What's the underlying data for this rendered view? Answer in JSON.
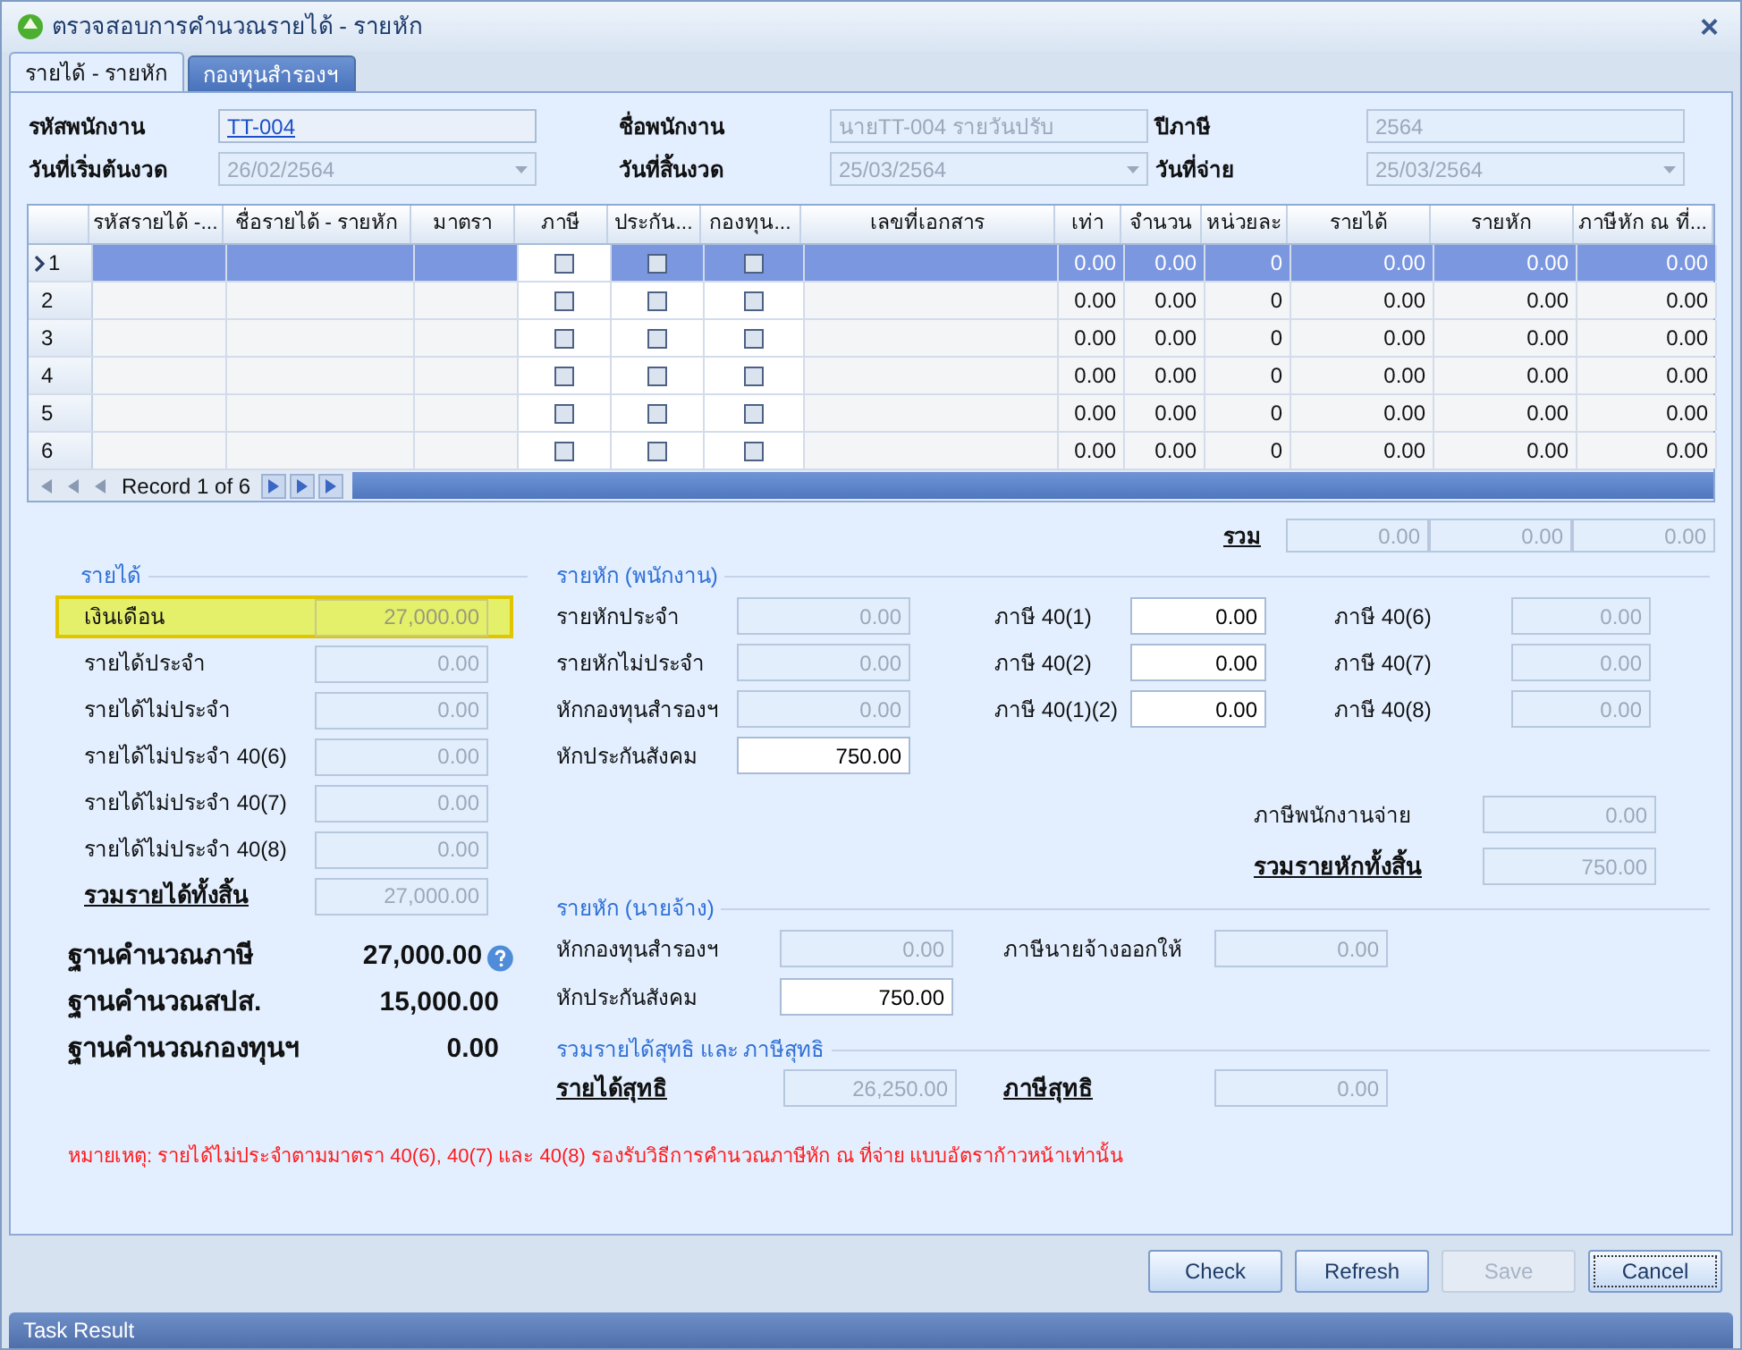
{
  "window": {
    "title": "ตรวจสอบการคำนวณรายได้ - รายหัก",
    "close": "×"
  },
  "tabs": [
    {
      "label": "รายได้ - รายหัก",
      "selected": true
    },
    {
      "label": "กองทุนสำรองฯ",
      "selected": false
    }
  ],
  "header_fields": [
    {
      "label": "รหัสพนักงาน",
      "value": "TT-004",
      "kind": "link"
    },
    {
      "label": "ชื่อพนักงาน",
      "value": "นายTT-004 รายวันปรับ",
      "kind": "text"
    },
    {
      "label": "ปีภาษี",
      "value": "2564",
      "kind": "text"
    },
    {
      "label": "วันที่เริ่มต้นงวด",
      "value": "26/02/2564",
      "kind": "date"
    },
    {
      "label": "วันที่สิ้นงวด",
      "value": "25/03/2564",
      "kind": "date"
    },
    {
      "label": "วันที่จ่าย",
      "value": "25/03/2564",
      "kind": "date"
    }
  ],
  "table": {
    "columns": [
      "รหัสรายได้ -...",
      "ชื่อรายได้ - รายหัก",
      "มาตรา",
      "ภาษี",
      "ประกัน...",
      "กองทุน...",
      "เลขที่เอกสาร",
      "เท่า",
      "จำนวน",
      "หน่วยละ",
      "รายได้",
      "รายหัก",
      "ภาษีหัก ณ ที่..."
    ],
    "rows": [
      {
        "number": "1",
        "selected": true,
        "tax": false,
        "insurance": false,
        "fund": false,
        "values": [
          "0.00",
          "0.00",
          "0",
          "0.00",
          "0.00",
          "0.00"
        ]
      },
      {
        "number": "2",
        "selected": false,
        "tax": false,
        "insurance": false,
        "fund": false,
        "values": [
          "0.00",
          "0.00",
          "0",
          "0.00",
          "0.00",
          "0.00"
        ]
      },
      {
        "number": "3",
        "selected": false,
        "tax": false,
        "insurance": false,
        "fund": false,
        "values": [
          "0.00",
          "0.00",
          "0",
          "0.00",
          "0.00",
          "0.00"
        ]
      },
      {
        "number": "4",
        "selected": false,
        "tax": false,
        "insurance": false,
        "fund": false,
        "values": [
          "0.00",
          "0.00",
          "0",
          "0.00",
          "0.00",
          "0.00"
        ]
      },
      {
        "number": "5",
        "selected": false,
        "tax": false,
        "insurance": false,
        "fund": false,
        "values": [
          "0.00",
          "0.00",
          "0",
          "0.00",
          "0.00",
          "0.00"
        ]
      },
      {
        "number": "6",
        "selected": false,
        "tax": false,
        "insurance": false,
        "fund": false,
        "values": [
          "0.00",
          "0.00",
          "0",
          "0.00",
          "0.00",
          "0.00"
        ]
      }
    ],
    "navigator": "Record 1 of 6",
    "total_label": "รวม",
    "totals": [
      "0.00",
      "0.00",
      "0.00"
    ]
  },
  "income": {
    "legend": "รายได้",
    "fields": [
      {
        "label": "เงินเดือน",
        "value": "27,000.00",
        "disabled": true,
        "highlighted": true,
        "kind": "normal"
      },
      {
        "label": "รายได้ประจำ",
        "value": "0.00",
        "disabled": true,
        "highlighted": false,
        "kind": "normal"
      },
      {
        "label": "รายได้ไม่ประจำ",
        "value": "0.00",
        "disabled": true,
        "highlighted": false,
        "kind": "normal"
      },
      {
        "label": "รายได้ไม่ประจำ 40(6)",
        "value": "0.00",
        "disabled": true,
        "highlighted": false,
        "kind": "normal"
      },
      {
        "label": "รายได้ไม่ประจำ 40(7)",
        "value": "0.00",
        "disabled": true,
        "highlighted": false,
        "kind": "normal"
      },
      {
        "label": "รายได้ไม่ประจำ 40(8)",
        "value": "0.00",
        "disabled": true,
        "highlighted": false,
        "kind": "normal"
      },
      {
        "label": "รวมรายได้ทั้งสิ้น",
        "value": "27,000.00",
        "disabled": true,
        "highlighted": false,
        "kind": "total"
      }
    ],
    "bases": [
      {
        "label": "ฐานคำนวณภาษี",
        "value": "27,000.00",
        "help": true
      },
      {
        "label": "ฐานคำนวณสปส.",
        "value": "15,000.00",
        "help": false
      },
      {
        "label": "ฐานคำนวณกองทุนฯ",
        "value": "0.00",
        "help": false
      }
    ]
  },
  "employee_deductions": {
    "legend": "รายหัก (พนักงาน)",
    "rows": [
      [
        {
          "label": "รายหักประจำ",
          "value": "0.00",
          "disabled": true
        },
        {
          "label": "ภาษี 40(1)",
          "value": "0.00",
          "disabled": false
        },
        {
          "label": "ภาษี 40(6)",
          "value": "0.00",
          "disabled": true
        }
      ],
      [
        {
          "label": "รายหักไม่ประจำ",
          "value": "0.00",
          "disabled": true
        },
        {
          "label": "ภาษี 40(2)",
          "value": "0.00",
          "disabled": false
        },
        {
          "label": "ภาษี 40(7)",
          "value": "0.00",
          "disabled": true
        }
      ],
      [
        {
          "label": "หักกองทุนสำรองฯ",
          "value": "0.00",
          "disabled": true
        },
        {
          "label": "ภาษี 40(1)(2)",
          "value": "0.00",
          "disabled": false
        },
        {
          "label": "ภาษี 40(8)",
          "value": "0.00",
          "disabled": true
        }
      ],
      [
        {
          "label": "หักประกันสังคม",
          "value": "750.00",
          "disabled": false
        }
      ]
    ],
    "summary": [
      {
        "label": "ภาษีพนักงานจ่าย",
        "value": "0.00",
        "disabled": true,
        "kind": "normal"
      },
      {
        "label": "รวมรายหักทั้งสิ้น",
        "value": "750.00",
        "disabled": true,
        "kind": "total"
      }
    ]
  },
  "employer_deductions": {
    "legend": "รายหัก (นายจ้าง)",
    "rows": [
      [
        {
          "label": "หักกองทุนสำรองฯ",
          "value": "0.00",
          "disabled": true
        },
        {
          "label": "ภาษีนายจ้างออกให้",
          "value": "0.00",
          "disabled": true
        }
      ],
      [
        {
          "label": "หักประกันสังคม",
          "value": "750.00",
          "disabled": false
        }
      ]
    ]
  },
  "net": {
    "legend": "รวมรายได้สุทธิ และ ภาษีสุทธิ",
    "fields": [
      {
        "label": "รายได้สุทธิ",
        "value": "26,250.00",
        "disabled": true
      },
      {
        "label": "ภาษีสุทธิ",
        "value": "0.00",
        "disabled": true
      }
    ]
  },
  "note": "หมายเหตุ: รายได้ไม่ประจำตามมาตรา 40(6), 40(7) และ 40(8)  รองรับวิธีการคำนวณภาษีหัก ณ ที่จ่าย แบบอัตราก้าวหน้าเท่านั้น",
  "buttons": [
    {
      "label": "Check",
      "disabled": false,
      "focused": false
    },
    {
      "label": "Refresh",
      "disabled": false,
      "focused": false
    },
    {
      "label": "Save",
      "disabled": true,
      "focused": false
    },
    {
      "label": "Cancel",
      "disabled": false,
      "focused": true
    }
  ],
  "task_bar": "Task Result"
}
